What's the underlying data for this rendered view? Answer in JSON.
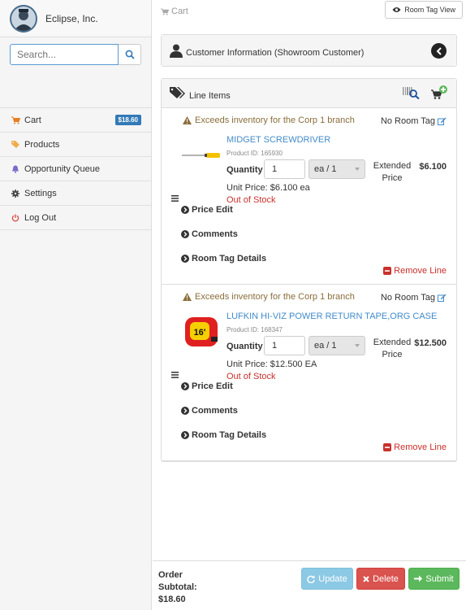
{
  "sidebar": {
    "brand": "Eclipse, Inc.",
    "search_placeholder": "Search...",
    "items": [
      {
        "label": "Cart",
        "icon": "cart-icon",
        "badge": "$18.60"
      },
      {
        "label": "Products",
        "icon": "tags-icon"
      },
      {
        "label": "Opportunity Queue",
        "icon": "bell-icon"
      },
      {
        "label": "Settings",
        "icon": "gear-icon"
      },
      {
        "label": "Log Out",
        "icon": "power-icon"
      }
    ]
  },
  "topbar": {
    "breadcrumb": "Cart",
    "room_tag_view": "Room Tag View"
  },
  "customer": {
    "title": "Customer Information (Showroom Customer)"
  },
  "line_items": {
    "title": "Line Items",
    "items": [
      {
        "warning": "Exceeds inventory for the Corp 1 branch",
        "room_tag": "No Room Tag",
        "name": "MIDGET SCREWDRIVER",
        "product_id": "Product ID: 165930",
        "quantity_label": "Quantity",
        "quantity": "1",
        "uom": "ea / 1",
        "unit_price": "Unit Price: $6.100 ea",
        "stock": "Out of Stock",
        "ext_label": "Extended Price",
        "ext_value": "$6.100",
        "price_edit": "Price Edit",
        "comments": "Comments",
        "room_tag_details": "Room Tag Details",
        "remove": "Remove Line"
      },
      {
        "warning": "Exceeds inventory for the Corp 1 branch",
        "room_tag": "No Room Tag",
        "name": "LUFKIN HI-VIZ POWER RETURN TAPE,ORG CASE",
        "product_id": "Product ID: 168347",
        "quantity_label": "Quantity",
        "quantity": "1",
        "uom": "ea / 1",
        "unit_price": "Unit Price: $12.500 EA",
        "stock": "Out of Stock",
        "ext_label": "Extended Price",
        "ext_value": "$12.500",
        "price_edit": "Price Edit",
        "comments": "Comments",
        "room_tag_details": "Room Tag Details",
        "remove": "Remove Line",
        "image_text": "16'"
      }
    ]
  },
  "footer": {
    "subtotal_label_1": "Order",
    "subtotal_label_2": "Subtotal:",
    "subtotal_value": "$18.60",
    "update": "Update",
    "delete": "Delete",
    "submit": "Submit"
  },
  "colors": {
    "link": "#428bca",
    "danger": "#d9534f",
    "success": "#5cb85c",
    "info": "#8cc9e4",
    "warning_text": "#8a6d3b",
    "badge": "#337ab7"
  }
}
